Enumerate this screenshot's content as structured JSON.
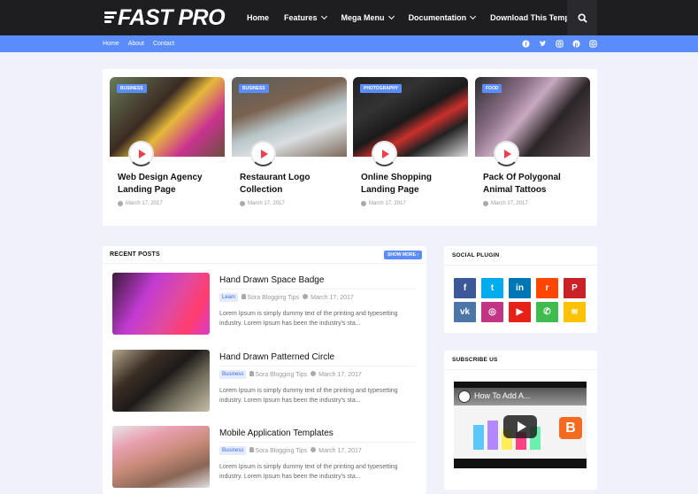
{
  "header": {
    "logo": "FAST PRO",
    "nav": [
      {
        "label": "Home",
        "dropdown": false
      },
      {
        "label": "Features",
        "dropdown": true
      },
      {
        "label": "Mega Menu",
        "dropdown": true
      },
      {
        "label": "Documentation",
        "dropdown": true
      },
      {
        "label": "Download This Template",
        "dropdown": false
      }
    ],
    "search_icon": "search-icon"
  },
  "subbar": {
    "links": [
      "Home",
      "About",
      "Contact"
    ],
    "social_icons": [
      "facebook-icon",
      "twitter-icon",
      "instagram-icon",
      "pinterest-icon",
      "instagram-icon"
    ]
  },
  "featured": [
    {
      "tag": "BUSINESS",
      "title": "Web Design Agency Landing Page",
      "date": "March 17, 2017"
    },
    {
      "tag": "BUSINESS",
      "title": "Restaurant Logo Collection",
      "date": "March 17, 2017"
    },
    {
      "tag": "PHOTOGRAPHY",
      "title": "Online Shopping Landing Page",
      "date": "March 17, 2017"
    },
    {
      "tag": "FOOD",
      "title": "Pack Of Polygonal Animal Tattoos",
      "date": "March 17, 2017"
    }
  ],
  "recent": {
    "heading": "RECENT POSTS",
    "show_more": "SHOW MORE ›",
    "posts": [
      {
        "title": "Hand Drawn Space Badge",
        "label": "Learn",
        "author": "Sora Blogging Tips",
        "date": "March 17, 2017",
        "excerpt": "Lorem Ipsum is simply dummy text of the printing and typesetting industry. Lorem Ipsum has been the industry's sta..."
      },
      {
        "title": "Hand Drawn Patterned Circle",
        "label": "Business",
        "author": "Sora Blogging Tips",
        "date": "March 17, 2017",
        "excerpt": "Lorem Ipsum is simply dummy text of the printing and typesetting industry. Lorem Ipsum has been the industry's sta..."
      },
      {
        "title": "Mobile Application Templates",
        "label": "Business",
        "author": "Sora Blogging Tips",
        "date": "March 17, 2017",
        "excerpt": "Lorem Ipsum is simply dummy text of the printing and typesetting industry. Lorem Ipsum has been the industry's sta..."
      }
    ]
  },
  "social_plugin": {
    "heading": "SOCIAL PLUGIN",
    "buttons": [
      {
        "name": "facebook",
        "glyph": "f",
        "color": "#3b5999"
      },
      {
        "name": "twitter",
        "glyph": "t",
        "color": "#00acee"
      },
      {
        "name": "linkedin",
        "glyph": "in",
        "color": "#0077b5"
      },
      {
        "name": "reddit",
        "glyph": "r",
        "color": "#ff4500"
      },
      {
        "name": "pinterest",
        "glyph": "P",
        "color": "#ca2127"
      },
      {
        "name": "vk",
        "glyph": "vk",
        "color": "#4a76a8"
      },
      {
        "name": "instagram",
        "glyph": "◎",
        "color": "#c13584"
      },
      {
        "name": "youtube",
        "glyph": "▶",
        "color": "#e62117"
      },
      {
        "name": "whatsapp",
        "glyph": "✆",
        "color": "#3fbb50"
      },
      {
        "name": "rss",
        "glyph": "≋",
        "color": "#ffc200"
      }
    ]
  },
  "subscribe": {
    "heading": "SUBSCRIBE US",
    "video_title": "How To Add A..."
  },
  "colors": {
    "accent": "#5b8cfb",
    "topbar": "#1e1e21",
    "background": "#f0f1fb",
    "play": "#ee3e4e"
  }
}
